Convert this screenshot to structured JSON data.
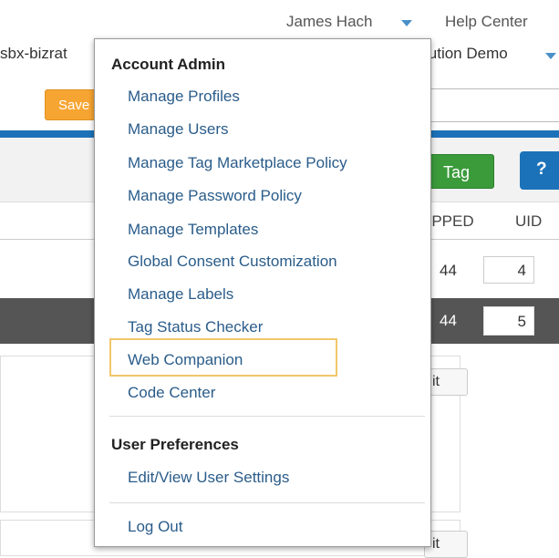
{
  "header": {
    "user_name": "James Hach",
    "help_center": "Help Center",
    "account": "sbx-bizrat",
    "profile": "lution Demo"
  },
  "toolbar": {
    "save_label": "Save",
    "tag_label": "Tag",
    "help_label": "?"
  },
  "table": {
    "columns": [
      "APPED",
      "UID"
    ],
    "rows": [
      {
        "count": "44",
        "uid": "4"
      },
      {
        "count": "44",
        "uid": "5"
      }
    ],
    "edit_label": "it"
  },
  "menu": {
    "sections": [
      {
        "heading": "Account Admin",
        "items": [
          "Manage Profiles",
          "Manage Users",
          "Manage Tag Marketplace Policy",
          "Manage Password Policy",
          "Manage Templates",
          "Global Consent Customization",
          "Manage Labels",
          "Tag Status Checker",
          "Web Companion",
          "Code Center"
        ]
      },
      {
        "heading": "User Preferences",
        "items": [
          "Edit/View User Settings"
        ]
      }
    ],
    "logout": "Log Out",
    "highlight_color": "#f2c66a"
  }
}
